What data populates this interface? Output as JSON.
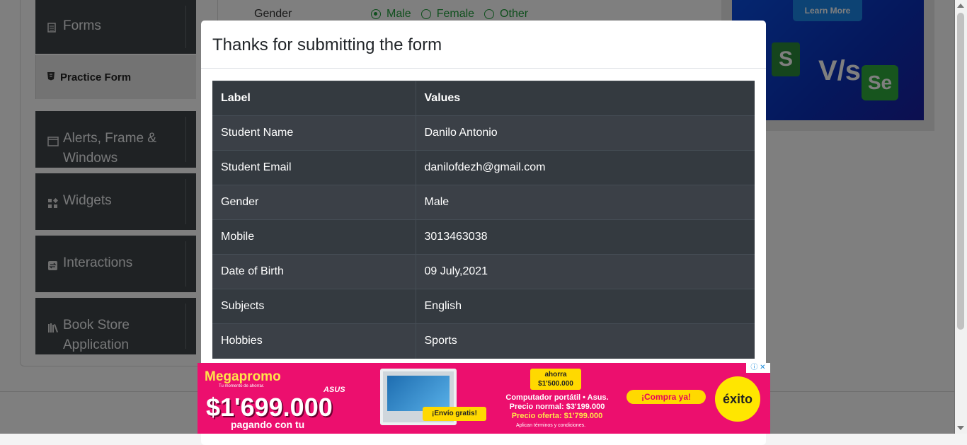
{
  "background": {
    "gender_label": "Gender",
    "gender_options": [
      "Male",
      "Female",
      "Other"
    ],
    "promo_button": "Learn More",
    "promo_vs": "V/s",
    "promo_logo_left": "S",
    "promo_logo_right": "Se"
  },
  "sidebar": {
    "forms": "Forms",
    "practice_form": "Practice Form",
    "alerts_line1": "Alerts, Frame &",
    "alerts_line2": "Windows",
    "widgets": "Widgets",
    "interactions": "Interactions",
    "book_line1": "Book Store",
    "book_line2": "Application"
  },
  "modal": {
    "title": "Thanks for submitting the form",
    "header_label": "Label",
    "header_values": "Values",
    "rows": [
      {
        "label": "Student Name",
        "value": "Danilo Antonio"
      },
      {
        "label": "Student Email",
        "value": "danilofdezh@gmail.com"
      },
      {
        "label": "Gender",
        "value": "Male"
      },
      {
        "label": "Mobile",
        "value": "3013463038"
      },
      {
        "label": "Date of Birth",
        "value": "09 July,2021"
      },
      {
        "label": "Subjects",
        "value": "English"
      },
      {
        "label": "Hobbies",
        "value": "Sports"
      }
    ]
  },
  "ad": {
    "megapromo": "Megapromo",
    "megapromo_sub": "Tu momento de ahorrar.",
    "brand": "ASUS",
    "price": "$1'699.000",
    "pagando": "pagando con tu",
    "envio": "¡Envío gratis!",
    "ahorra_line1": "ahorra",
    "ahorra_line2": "$1'500.000",
    "desc_line1": "Computador portátil • Asus.",
    "desc_line2": "Precio normal: $3'199.000",
    "desc_line3": "Precio oferta: $1'799.000",
    "conditions": "Aplican términos y condiciones.",
    "cta": "¡Compra ya!",
    "store": "éxito"
  }
}
